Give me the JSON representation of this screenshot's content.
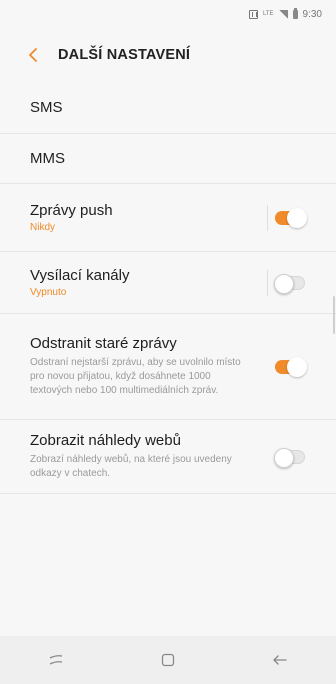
{
  "status_bar": {
    "network": "LTE",
    "time": "9:30"
  },
  "header": {
    "title": "DALŠÍ NASTAVENÍ"
  },
  "rows": {
    "sms": {
      "title": "SMS"
    },
    "mms": {
      "title": "MMS"
    },
    "push": {
      "title": "Zprávy push",
      "subtitle": "Nikdy",
      "enabled": true
    },
    "broadcast": {
      "title": "Vysílací kanály",
      "subtitle": "Vypnuto",
      "enabled": false
    },
    "delete_old": {
      "title": "Odstranit staré zprávy",
      "description": "Odstraní nejstarší zprávu, aby se uvolnilo místo pro novou přijatou, když dosáhnete 1000 textových nebo 100 multimediálních zpráv.",
      "enabled": true
    },
    "previews": {
      "title": "Zobrazit náhledy webů",
      "description": "Zobrazí náhledy webů, na které jsou uvedeny odkazy v chatech.",
      "enabled": false
    }
  },
  "colors": {
    "accent": "#f08a2a",
    "background": "#f7f7f7"
  },
  "nav": {
    "icons": [
      "recent-apps-icon",
      "home-icon",
      "back-icon"
    ]
  }
}
